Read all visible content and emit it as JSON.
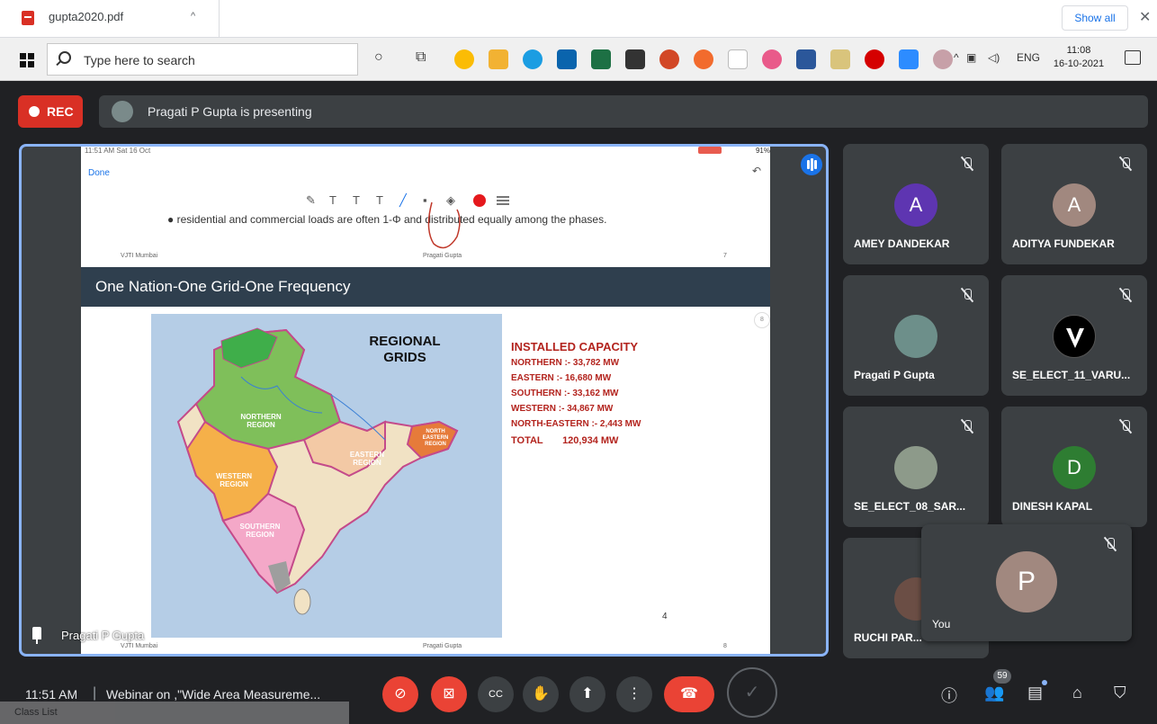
{
  "download_bar": {
    "file_name": "gupta2020.pdf",
    "chevron": "^",
    "show_all_label": "Show all",
    "close_glyph": "✕"
  },
  "taskbar": {
    "search_placeholder": "Type here to search",
    "tray_language": "ENG",
    "clock_time": "11:08",
    "clock_date": "16-10-2021"
  },
  "meet": {
    "rec_label": "REC",
    "presenting_text": "Pragati P Gupta is presenting",
    "presenter_name": "Pragati P Gupta",
    "meeting_time": "11:51 AM",
    "meeting_title": "Webinar on ,\"Wide Area Measureme...",
    "participant_count": "59",
    "self_label": "You",
    "self_initial": "P"
  },
  "slide": {
    "ipad_status_left": "11:51 AM  Sat 16 Oct",
    "ipad_battery": "91%",
    "done_label": "Done",
    "bullet_text": "residential and commercial loads are often 1-Φ and distributed equally among the phases.",
    "prev_footer_left": "VJTI Mumbai",
    "prev_footer_center": "Pragati Gupta",
    "prev_footer_right": "7",
    "title": "One Nation-One Grid-One Frequency",
    "side_page_num": "8",
    "map_title_line1": "REGIONAL",
    "map_title_line2": "GRIDS",
    "regions": {
      "northern": "NORTHERN REGION",
      "eastern": "EASTERN REGION",
      "western": "WESTERN REGION",
      "southern": "SOUTHERN REGION",
      "north_eastern": "NORTH EASTERN REGION"
    },
    "capacity_title": "INSTALLED CAPACITY",
    "capacity_lines": [
      "NORTHERN :- 33,782 MW",
      "EASTERN  :- 16,680 MW",
      "SOUTHERN :- 33,162 MW",
      "WESTERN :- 34,867 MW",
      "NORTH-EASTERN :- 2,443 MW"
    ],
    "capacity_total_label": "TOTAL",
    "capacity_total_value": "120,934 MW",
    "page_number": "4",
    "footer_left": "VJTI Mumbai",
    "footer_center": "Pragati Gupta",
    "footer_right": "8"
  },
  "tiles": [
    {
      "name": "AMEY DANDEKAR",
      "initial": "A",
      "color": "#5e35b1"
    },
    {
      "name": "ADITYA FUNDEKAR",
      "initial": "A",
      "color": "#a1887f"
    },
    {
      "name": "Pragati P Gupta",
      "initial": "",
      "color": "#6d8f8a"
    },
    {
      "name": "SE_ELECT_11_VARU...",
      "initial": "",
      "color": "#000000"
    },
    {
      "name": "SE_ELECT_08_SAR...",
      "initial": "",
      "color": "#8d9a8a"
    },
    {
      "name": "DINESH KAPAL",
      "initial": "D",
      "color": "#2e7d32"
    },
    {
      "name": "RUCHI PAR...",
      "initial": "",
      "color": "#6b4e45"
    }
  ],
  "taskbar_bottom": {
    "class_list_label": "Class List"
  },
  "colors": {
    "meet_bg": "#202124",
    "tile_bg": "#3c4043",
    "accent_blue": "#8ab4f8",
    "danger_red": "#ea4335",
    "capacity_red": "#b3231d"
  }
}
